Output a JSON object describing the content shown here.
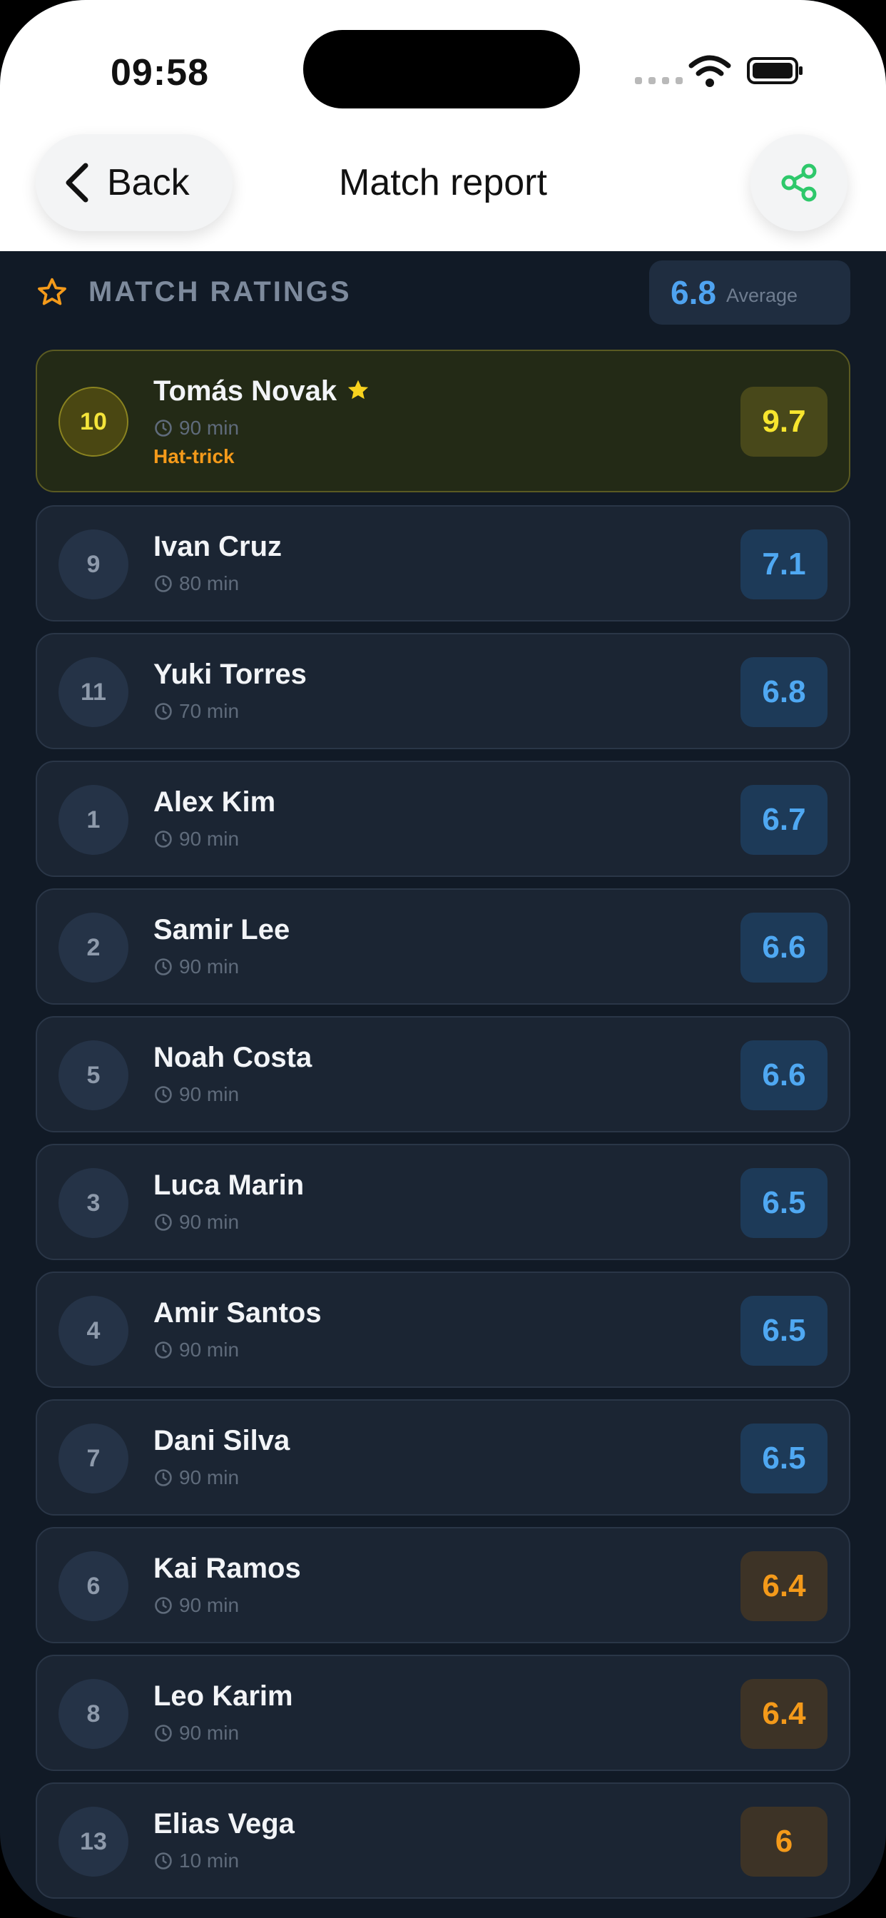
{
  "status": {
    "time": "09:58"
  },
  "nav": {
    "back_label": "Back",
    "title": "Match report"
  },
  "section": {
    "title": "MATCH RATINGS",
    "average_value": "6.8",
    "average_label": "Average"
  },
  "players": [
    {
      "number": "10",
      "name": "Tomás Novak",
      "minutes": "90 min",
      "badge": "Hat-trick",
      "rating": "9.7",
      "tier": "top"
    },
    {
      "number": "9",
      "name": "Ivan Cruz",
      "minutes": "80 min",
      "rating": "7.1",
      "tier": "blue"
    },
    {
      "number": "11",
      "name": "Yuki Torres",
      "minutes": "70 min",
      "rating": "6.8",
      "tier": "blue"
    },
    {
      "number": "1",
      "name": "Alex Kim",
      "minutes": "90 min",
      "rating": "6.7",
      "tier": "blue"
    },
    {
      "number": "2",
      "name": "Samir Lee",
      "minutes": "90 min",
      "rating": "6.6",
      "tier": "blue"
    },
    {
      "number": "5",
      "name": "Noah Costa",
      "minutes": "90 min",
      "rating": "6.6",
      "tier": "blue"
    },
    {
      "number": "3",
      "name": "Luca Marin",
      "minutes": "90 min",
      "rating": "6.5",
      "tier": "blue"
    },
    {
      "number": "4",
      "name": "Amir Santos",
      "minutes": "90 min",
      "rating": "6.5",
      "tier": "blue"
    },
    {
      "number": "7",
      "name": "Dani Silva",
      "minutes": "90 min",
      "rating": "6.5",
      "tier": "blue"
    },
    {
      "number": "6",
      "name": "Kai Ramos",
      "minutes": "90 min",
      "rating": "6.4",
      "tier": "orange"
    },
    {
      "number": "8",
      "name": "Leo Karim",
      "minutes": "90 min",
      "rating": "6.4",
      "tier": "orange"
    },
    {
      "number": "13",
      "name": "Elias Vega",
      "minutes": "10 min",
      "rating": "6",
      "tier": "orange"
    }
  ],
  "colors": {
    "blue_rating": "#4fa8f2",
    "orange_rating": "#f49a1a",
    "top_rating": "#f7e52e",
    "share_icon": "#2ec86b"
  },
  "icons": {
    "back": "chevron-left-icon",
    "share": "share-icon",
    "section": "star-outline-icon",
    "player_star": "star-filled-icon",
    "minutes": "clock-icon"
  }
}
